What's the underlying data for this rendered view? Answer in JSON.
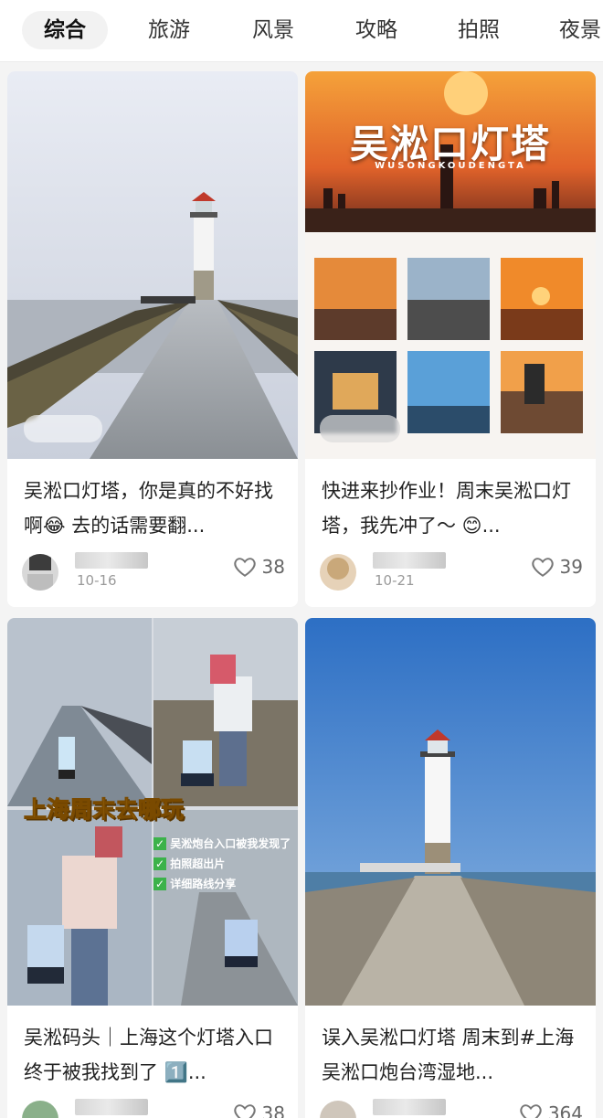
{
  "tabs": [
    "综合",
    "旅游",
    "风景",
    "攻略",
    "拍照",
    "夜景"
  ],
  "cards": [
    {
      "title": "吴淞口灯塔，你是真的不好找啊😂 去的话需要翻...",
      "date": "10-16",
      "likes": "38"
    },
    {
      "title": "快进来抄作业！周末吴淞口灯塔，我先冲了～ 😊...",
      "date": "10-21",
      "likes": "39",
      "cover_title": "吴淞口灯塔",
      "cover_subtitle": "WUSONGKOUDENGTA"
    },
    {
      "title": "吴淞码头｜上海这个灯塔入口终于被我找到了 1️⃣...",
      "date": "",
      "likes": "38",
      "overlay_title": "上海周末去哪玩",
      "checklist": [
        "吴淞炮台入口被我发现了",
        "拍照超出片",
        "详细路线分享"
      ]
    },
    {
      "title": "误入吴淞口灯塔 周末到#上海吴淞口炮台湾湿地...",
      "date": "",
      "likes": "364"
    }
  ],
  "icons": {
    "like": "heart-outline-icon"
  },
  "colors": {
    "accent_sunset": "#e8712a",
    "sky_blue": "#2d6fc4",
    "text": "#222222",
    "muted": "#9a9a9a"
  }
}
